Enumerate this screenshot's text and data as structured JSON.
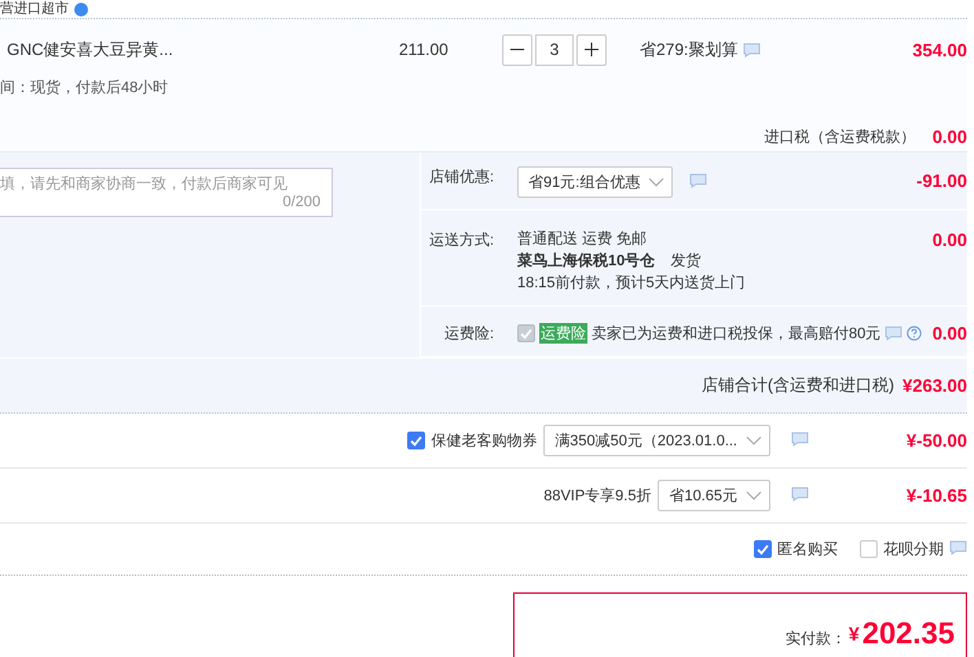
{
  "store_header": {
    "title": "营进口超市"
  },
  "item": {
    "name": "GNC健安喜大豆异黄...",
    "unit_price": "211.00",
    "quantity": "3",
    "promo": "省279:聚划算",
    "subtotal": "354.00",
    "delivery_note": "间：现货，付款后48小时"
  },
  "import_tax": {
    "label": "进口税（含运费税款）",
    "value": "0.00"
  },
  "message_field": {
    "placeholder": "填，请先和商家协商一致，付款后商家可见",
    "counter": "0/200"
  },
  "store_options": [
    {
      "kind": "select",
      "label": "店铺优惠:",
      "value": "省91元:组合优惠",
      "amount": "-91.00"
    },
    {
      "kind": "shipping",
      "label": "运送方式:",
      "lines": [
        "普通配送 运费 免邮",
        "**菜鸟上海保税10号仓**　发货",
        "18:15前付款，预计5天内送货上门"
      ],
      "amount": "0.00"
    },
    {
      "kind": "insurance",
      "label": "运费险:",
      "checked": true,
      "disabled": true,
      "tag": "运费险",
      "text": "卖家已为运费和进口税投保，最高赔付80元",
      "amount": "0.00"
    }
  ],
  "store_total": {
    "label": "店铺合计(含运费和进口税)",
    "value": "¥263.00"
  },
  "discounts": [
    {
      "kind": "checkbox",
      "checked": true,
      "label": "保健老客购物券",
      "value": "满350减50元（2023.01.0...",
      "amount": "¥-50.00"
    },
    {
      "kind": "plain",
      "label": "88VIP专享9.5折",
      "value": "省10.65元",
      "amount": "¥-10.65"
    }
  ],
  "options": [
    {
      "label": "匿名购买",
      "checked": true
    },
    {
      "label": "花呗分期",
      "checked": false
    }
  ],
  "payment": {
    "label": "实付款：",
    "currency": "¥",
    "amount": "202.35"
  }
}
